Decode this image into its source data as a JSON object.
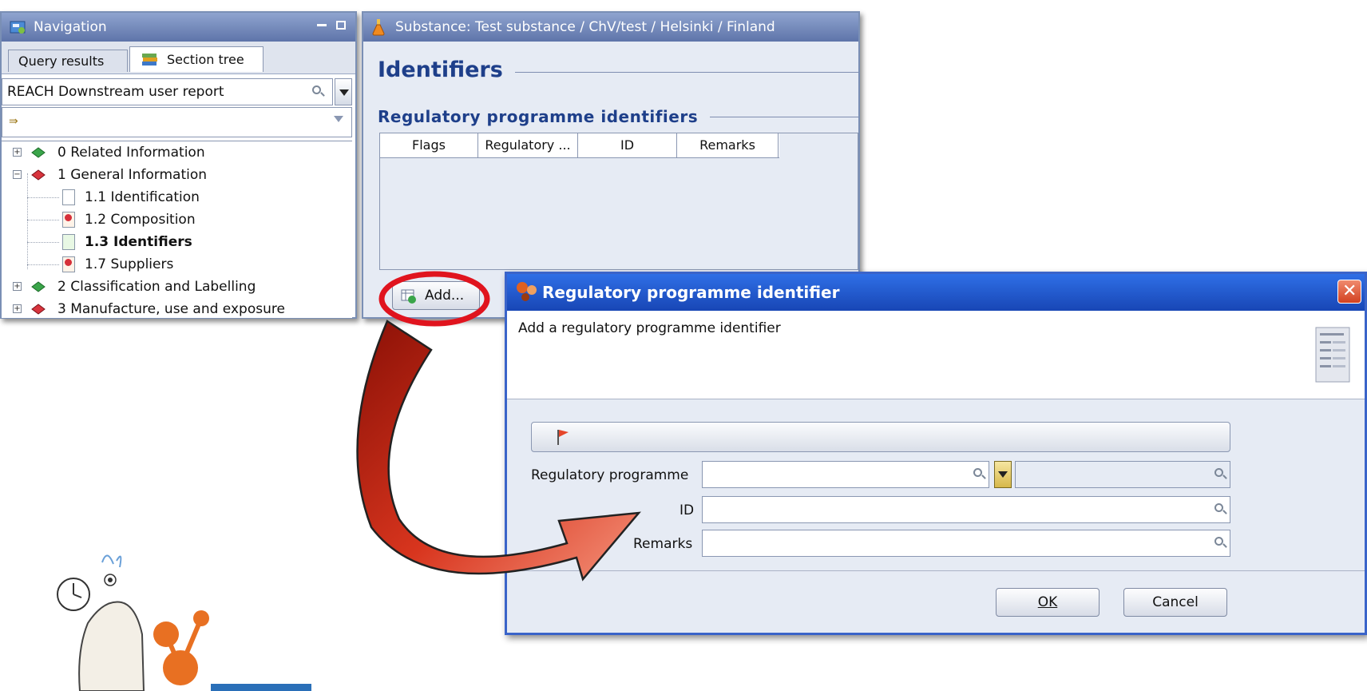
{
  "navigation": {
    "title": "Navigation",
    "tabs": [
      "Query results",
      "Section tree"
    ],
    "report_select": "REACH Downstream user report",
    "filter_value": "",
    "tree": [
      {
        "label": "0 Related Information",
        "level": 0,
        "expanded": false
      },
      {
        "label": "1 General Information",
        "level": 0,
        "expanded": true
      },
      {
        "label": "1.1 Identification",
        "level": 1
      },
      {
        "label": "1.2 Composition",
        "level": 1
      },
      {
        "label": "1.3 Identifiers",
        "level": 1,
        "bold": true
      },
      {
        "label": "1.7 Suppliers",
        "level": 1
      },
      {
        "label": "2 Classification and Labelling",
        "level": 0,
        "expanded": false
      },
      {
        "label": "3 Manufacture, use and exposure",
        "level": 0,
        "expanded": false
      }
    ]
  },
  "substance": {
    "title": "Substance: Test substance / ChV/test / Helsinki / Finland",
    "heading": "Identifiers",
    "subheading": "Regulatory programme identifiers",
    "columns": [
      "Flags",
      "Regulatory ...",
      "ID",
      "Remarks"
    ],
    "add_button": "Add..."
  },
  "dialog": {
    "title": "Regulatory programme identifier",
    "description": "Add a regulatory programme identifier",
    "fields": {
      "regulatory_programme_label": "Regulatory programme",
      "id_label": "ID",
      "remarks_label": "Remarks"
    },
    "ok": "OK",
    "cancel": "Cancel"
  },
  "colors": {
    "highlight_ring": "#e0141e",
    "arrow": "#c8281a",
    "title_blue": "#1e3f8a"
  }
}
